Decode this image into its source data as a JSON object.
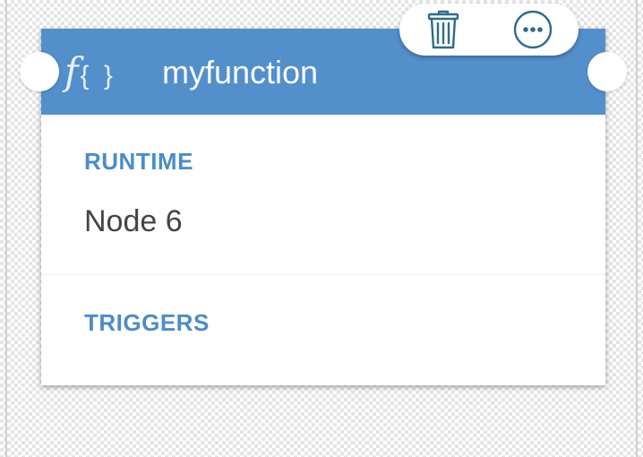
{
  "function_card": {
    "icon": "function-icon",
    "icon_glyph": "f",
    "icon_braces": "{ }",
    "title": "myfunction",
    "header_color": "#528fcb",
    "runtime_label": "RUNTIME",
    "runtime_value": "Node 6",
    "triggers_label": "TRIGGERS",
    "label_color": "#4a8ccc"
  },
  "toolbar": {
    "buttons": [
      {
        "icon": "trash-icon",
        "action": "delete"
      },
      {
        "icon": "more-options-icon",
        "action": "more"
      }
    ],
    "icon_color": "#2e6a8e"
  }
}
